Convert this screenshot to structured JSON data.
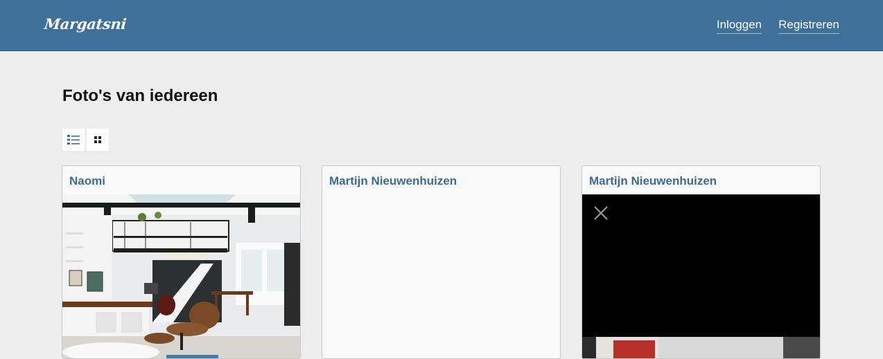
{
  "header": {
    "logo": "Margatsni",
    "nav": {
      "login": "Inloggen",
      "register": "Registreren"
    },
    "background": "#3e7199"
  },
  "main": {
    "title": "Foto's van iedereen",
    "view_toggle": {
      "list_icon": "list-icon",
      "grid_icon": "grid-icon"
    },
    "cards": [
      {
        "author": "Naomi",
        "photo": "interior-loft-photo"
      },
      {
        "author": "Martijn Nieuwenhuizen",
        "photo": "blank"
      },
      {
        "author": "Martijn Nieuwenhuizen",
        "photo": "video-player-black"
      }
    ]
  },
  "colors": {
    "accent": "#3e6b94",
    "page_background": "#ededed"
  }
}
